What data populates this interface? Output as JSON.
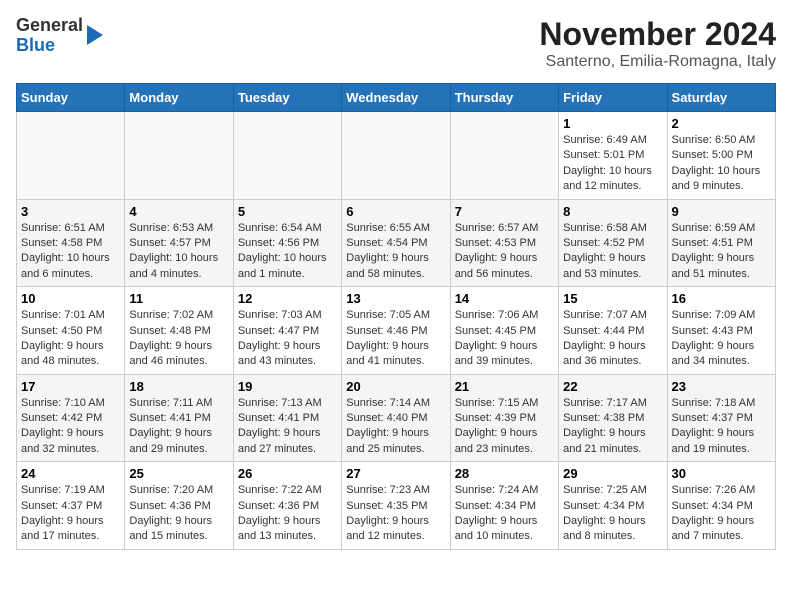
{
  "logo": {
    "line1": "General",
    "line2": "Blue"
  },
  "title": "November 2024",
  "location": "Santerno, Emilia-Romagna, Italy",
  "header": {
    "days": [
      "Sunday",
      "Monday",
      "Tuesday",
      "Wednesday",
      "Thursday",
      "Friday",
      "Saturday"
    ]
  },
  "weeks": [
    {
      "cells": [
        {
          "day": "",
          "info": ""
        },
        {
          "day": "",
          "info": ""
        },
        {
          "day": "",
          "info": ""
        },
        {
          "day": "",
          "info": ""
        },
        {
          "day": "",
          "info": ""
        },
        {
          "day": "1",
          "info": "Sunrise: 6:49 AM\nSunset: 5:01 PM\nDaylight: 10 hours and 12 minutes."
        },
        {
          "day": "2",
          "info": "Sunrise: 6:50 AM\nSunset: 5:00 PM\nDaylight: 10 hours and 9 minutes."
        }
      ]
    },
    {
      "cells": [
        {
          "day": "3",
          "info": "Sunrise: 6:51 AM\nSunset: 4:58 PM\nDaylight: 10 hours and 6 minutes."
        },
        {
          "day": "4",
          "info": "Sunrise: 6:53 AM\nSunset: 4:57 PM\nDaylight: 10 hours and 4 minutes."
        },
        {
          "day": "5",
          "info": "Sunrise: 6:54 AM\nSunset: 4:56 PM\nDaylight: 10 hours and 1 minute."
        },
        {
          "day": "6",
          "info": "Sunrise: 6:55 AM\nSunset: 4:54 PM\nDaylight: 9 hours and 58 minutes."
        },
        {
          "day": "7",
          "info": "Sunrise: 6:57 AM\nSunset: 4:53 PM\nDaylight: 9 hours and 56 minutes."
        },
        {
          "day": "8",
          "info": "Sunrise: 6:58 AM\nSunset: 4:52 PM\nDaylight: 9 hours and 53 minutes."
        },
        {
          "day": "9",
          "info": "Sunrise: 6:59 AM\nSunset: 4:51 PM\nDaylight: 9 hours and 51 minutes."
        }
      ]
    },
    {
      "cells": [
        {
          "day": "10",
          "info": "Sunrise: 7:01 AM\nSunset: 4:50 PM\nDaylight: 9 hours and 48 minutes."
        },
        {
          "day": "11",
          "info": "Sunrise: 7:02 AM\nSunset: 4:48 PM\nDaylight: 9 hours and 46 minutes."
        },
        {
          "day": "12",
          "info": "Sunrise: 7:03 AM\nSunset: 4:47 PM\nDaylight: 9 hours and 43 minutes."
        },
        {
          "day": "13",
          "info": "Sunrise: 7:05 AM\nSunset: 4:46 PM\nDaylight: 9 hours and 41 minutes."
        },
        {
          "day": "14",
          "info": "Sunrise: 7:06 AM\nSunset: 4:45 PM\nDaylight: 9 hours and 39 minutes."
        },
        {
          "day": "15",
          "info": "Sunrise: 7:07 AM\nSunset: 4:44 PM\nDaylight: 9 hours and 36 minutes."
        },
        {
          "day": "16",
          "info": "Sunrise: 7:09 AM\nSunset: 4:43 PM\nDaylight: 9 hours and 34 minutes."
        }
      ]
    },
    {
      "cells": [
        {
          "day": "17",
          "info": "Sunrise: 7:10 AM\nSunset: 4:42 PM\nDaylight: 9 hours and 32 minutes."
        },
        {
          "day": "18",
          "info": "Sunrise: 7:11 AM\nSunset: 4:41 PM\nDaylight: 9 hours and 29 minutes."
        },
        {
          "day": "19",
          "info": "Sunrise: 7:13 AM\nSunset: 4:41 PM\nDaylight: 9 hours and 27 minutes."
        },
        {
          "day": "20",
          "info": "Sunrise: 7:14 AM\nSunset: 4:40 PM\nDaylight: 9 hours and 25 minutes."
        },
        {
          "day": "21",
          "info": "Sunrise: 7:15 AM\nSunset: 4:39 PM\nDaylight: 9 hours and 23 minutes."
        },
        {
          "day": "22",
          "info": "Sunrise: 7:17 AM\nSunset: 4:38 PM\nDaylight: 9 hours and 21 minutes."
        },
        {
          "day": "23",
          "info": "Sunrise: 7:18 AM\nSunset: 4:37 PM\nDaylight: 9 hours and 19 minutes."
        }
      ]
    },
    {
      "cells": [
        {
          "day": "24",
          "info": "Sunrise: 7:19 AM\nSunset: 4:37 PM\nDaylight: 9 hours and 17 minutes."
        },
        {
          "day": "25",
          "info": "Sunrise: 7:20 AM\nSunset: 4:36 PM\nDaylight: 9 hours and 15 minutes."
        },
        {
          "day": "26",
          "info": "Sunrise: 7:22 AM\nSunset: 4:36 PM\nDaylight: 9 hours and 13 minutes."
        },
        {
          "day": "27",
          "info": "Sunrise: 7:23 AM\nSunset: 4:35 PM\nDaylight: 9 hours and 12 minutes."
        },
        {
          "day": "28",
          "info": "Sunrise: 7:24 AM\nSunset: 4:34 PM\nDaylight: 9 hours and 10 minutes."
        },
        {
          "day": "29",
          "info": "Sunrise: 7:25 AM\nSunset: 4:34 PM\nDaylight: 9 hours and 8 minutes."
        },
        {
          "day": "30",
          "info": "Sunrise: 7:26 AM\nSunset: 4:34 PM\nDaylight: 9 hours and 7 minutes."
        }
      ]
    }
  ]
}
